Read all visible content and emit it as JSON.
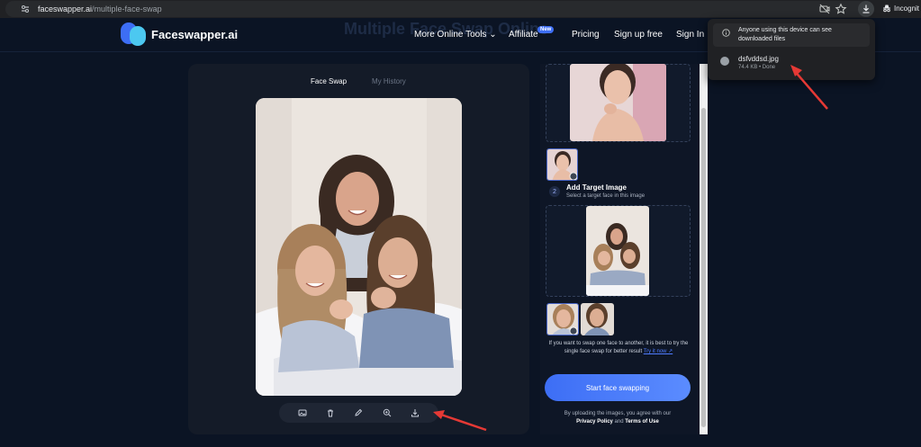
{
  "browser": {
    "url_domain": "faceswapper.ai",
    "url_path": "/multiple-face-swap",
    "profile_label": "Incognit"
  },
  "nav": {
    "logo_text": "Faceswapper.ai",
    "hero_ghost_title": "Multiple Face Swap Online",
    "more_tools": "More Online Tools",
    "affiliate": "Affiliate",
    "new_badge": "New",
    "pricing": "Pricing",
    "signup": "Sign up free",
    "signin": "Sign In"
  },
  "editor": {
    "tab_active": "Face Swap",
    "tab_history": "My History",
    "toolbar_icons": [
      "image-icon",
      "trash-icon",
      "edit-icon",
      "zoom-in-icon",
      "download-icon"
    ]
  },
  "right_panel": {
    "step_number": "2",
    "step_title": "Add Target Image",
    "step_subtitle": "Select a target face in this image",
    "hint_text": "If you want to swap one face to another, it is best to try the single face swap for better result",
    "hint_link": "Try it now ↗",
    "start_button": "Start face swapping",
    "terms_prefix": "By uploading the images, you agree with our",
    "privacy": "Privacy Policy",
    "and": "and",
    "terms": "Terms of Use"
  },
  "download_popup": {
    "notice": "Anyone using this device can see downloaded files",
    "file_name": "dsfvddsd.jpg",
    "file_meta": "74.4 KB • Done"
  },
  "colors": {
    "accent": "#3d6ef5",
    "page_bg": "#0b1424",
    "panel_bg": "#141b28",
    "arrow": "#e53935"
  }
}
